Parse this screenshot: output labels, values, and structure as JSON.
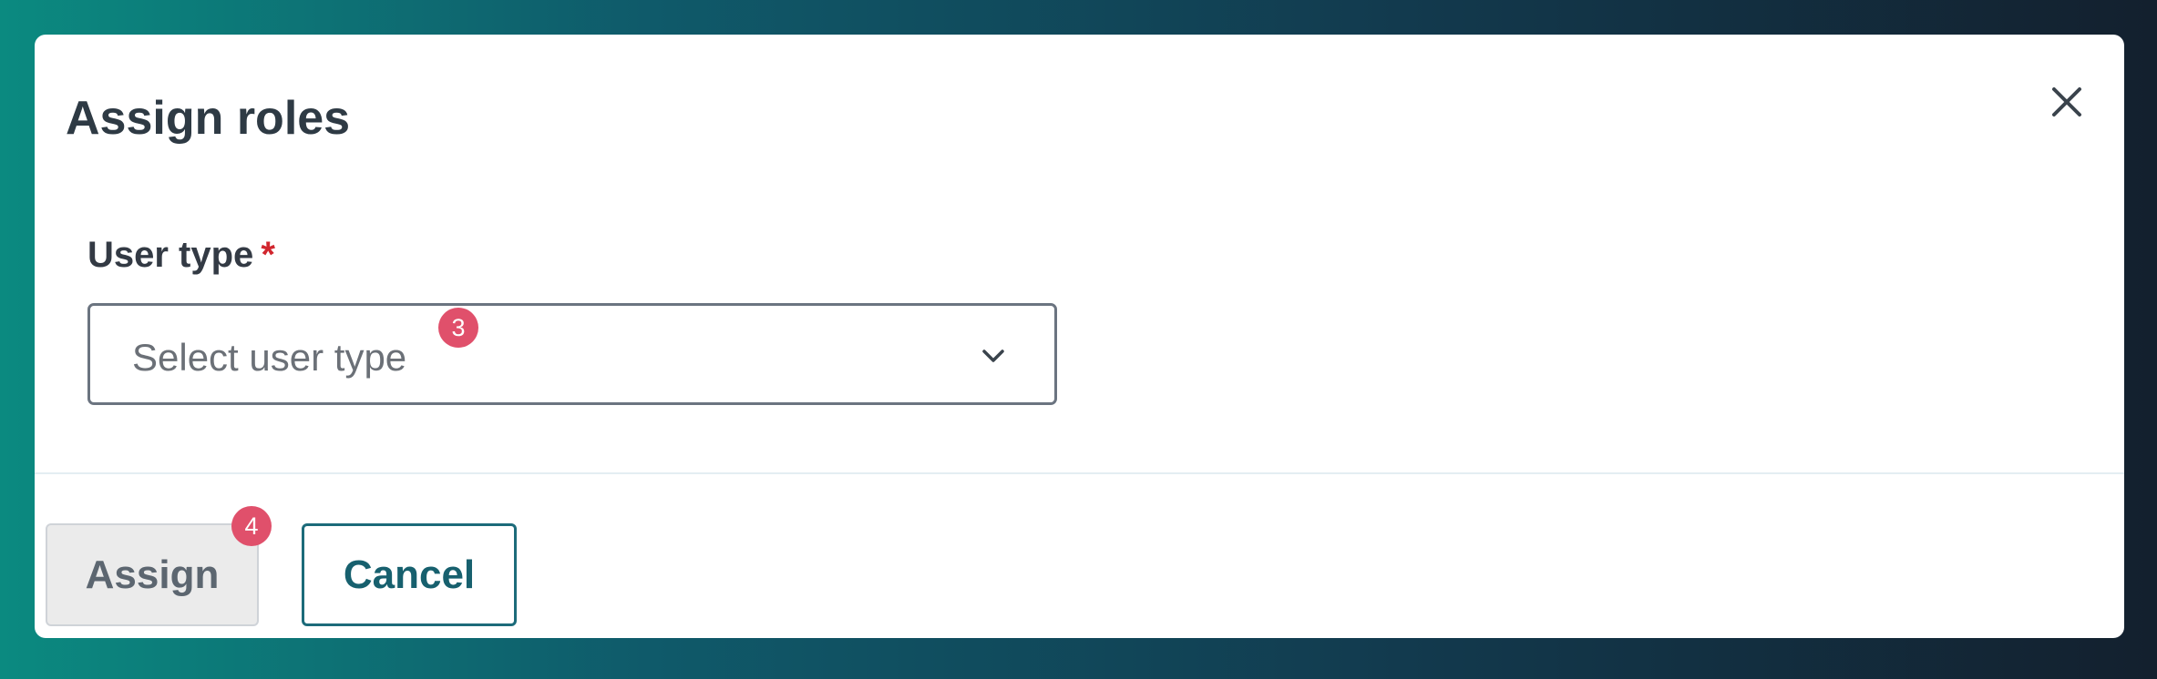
{
  "dialog": {
    "title": "Assign roles",
    "close_icon": "close-icon"
  },
  "form": {
    "user_type_label": "User type",
    "required_marker": "*",
    "user_type_placeholder": "Select user type",
    "dropdown_icon": "chevron-down-icon"
  },
  "badges": {
    "select_badge": "3",
    "assign_badge": "4"
  },
  "footer": {
    "assign_label": "Assign",
    "cancel_label": "Cancel"
  },
  "colors": {
    "required": "#d1262e",
    "badge": "#e0506b",
    "cancel_accent": "#17606e",
    "assign_disabled_bg": "#ebebeb"
  }
}
